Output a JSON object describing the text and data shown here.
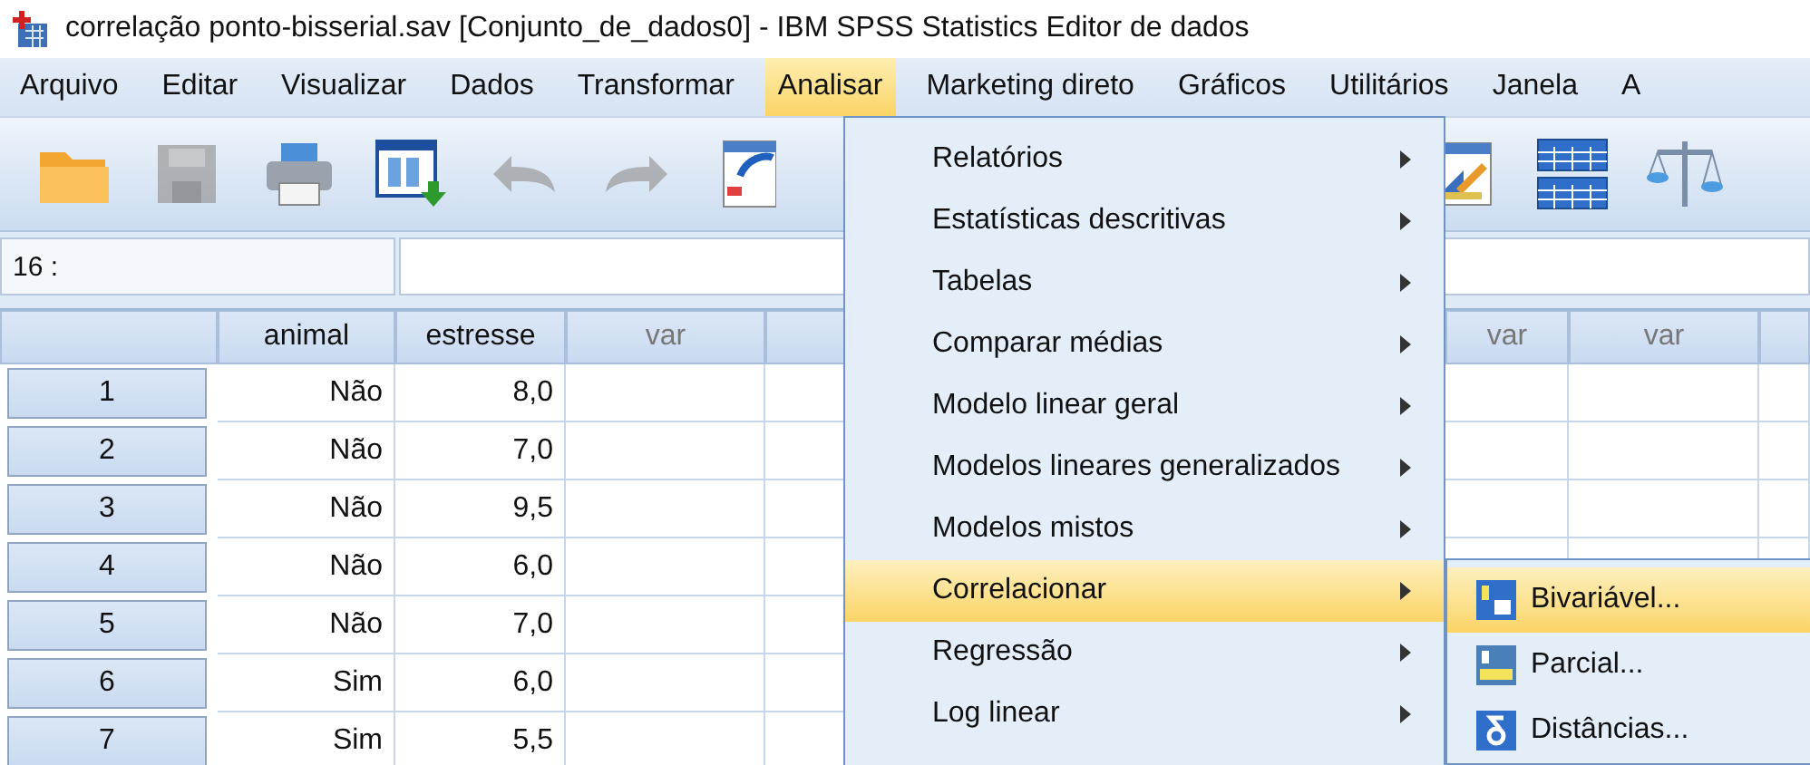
{
  "window": {
    "title": "correlação ponto-bisserial.sav [Conjunto_de_dados0] - IBM SPSS Statistics Editor de dados"
  },
  "menubar": [
    {
      "label": "Arquivo",
      "selected": false
    },
    {
      "label": "Editar",
      "selected": false
    },
    {
      "label": "Visualizar",
      "selected": false
    },
    {
      "label": "Dados",
      "selected": false
    },
    {
      "label": "Transformar",
      "selected": false
    },
    {
      "label": "Analisar",
      "selected": true
    },
    {
      "label": "Marketing direto",
      "selected": false
    },
    {
      "label": "Gráficos",
      "selected": false
    },
    {
      "label": "Utilitários",
      "selected": false
    },
    {
      "label": "Janela",
      "selected": false
    },
    {
      "label": "A",
      "selected": false
    }
  ],
  "toolbar_left": [
    {
      "kind": "open",
      "disabled": false
    },
    {
      "kind": "save",
      "disabled": true
    },
    {
      "kind": "print",
      "disabled": false
    },
    {
      "kind": "recall",
      "disabled": false
    },
    {
      "kind": "undo",
      "disabled": true
    },
    {
      "kind": "redo",
      "disabled": true
    },
    {
      "kind": "goto",
      "disabled": false
    }
  ],
  "toolbar_right": [
    {
      "kind": "variables",
      "disabled": false
    },
    {
      "kind": "split",
      "disabled": false
    },
    {
      "kind": "weight",
      "disabled": false
    }
  ],
  "cell_editor": {
    "reference": "16 :"
  },
  "grid": {
    "columns_left": [
      "animal",
      "estresse",
      "var"
    ],
    "columns_right": [
      "var",
      "var"
    ],
    "rows": [
      {
        "number": "1",
        "animal": "Não",
        "estresse": "8,0"
      },
      {
        "number": "2",
        "animal": "Não",
        "estresse": "7,0"
      },
      {
        "number": "3",
        "animal": "Não",
        "estresse": "9,5"
      },
      {
        "number": "4",
        "animal": "Não",
        "estresse": "6,0"
      },
      {
        "number": "5",
        "animal": "Não",
        "estresse": "7,0"
      },
      {
        "number": "6",
        "animal": "Sim",
        "estresse": "6,0"
      },
      {
        "number": "7",
        "animal": "Sim",
        "estresse": "5,5"
      }
    ]
  },
  "analyze_menu": [
    {
      "label": "Relatórios",
      "selected": false
    },
    {
      "label": "Estatísticas descritivas",
      "selected": false
    },
    {
      "label": "Tabelas",
      "selected": false
    },
    {
      "label": "Comparar médias",
      "selected": false
    },
    {
      "label": "Modelo linear geral",
      "selected": false
    },
    {
      "label": "Modelos lineares generalizados",
      "selected": false
    },
    {
      "label": "Modelos mistos",
      "selected": false
    },
    {
      "label": "Correlacionar",
      "selected": true
    },
    {
      "label": "Regressão",
      "selected": false
    },
    {
      "label": "Log linear",
      "selected": false
    }
  ],
  "correlate_submenu": [
    {
      "label": "Bivariável...",
      "kind": "bivariate",
      "selected": true
    },
    {
      "label": "Parcial...",
      "kind": "partial",
      "selected": false
    },
    {
      "label": "Distâncias...",
      "kind": "distance",
      "selected": false
    }
  ]
}
